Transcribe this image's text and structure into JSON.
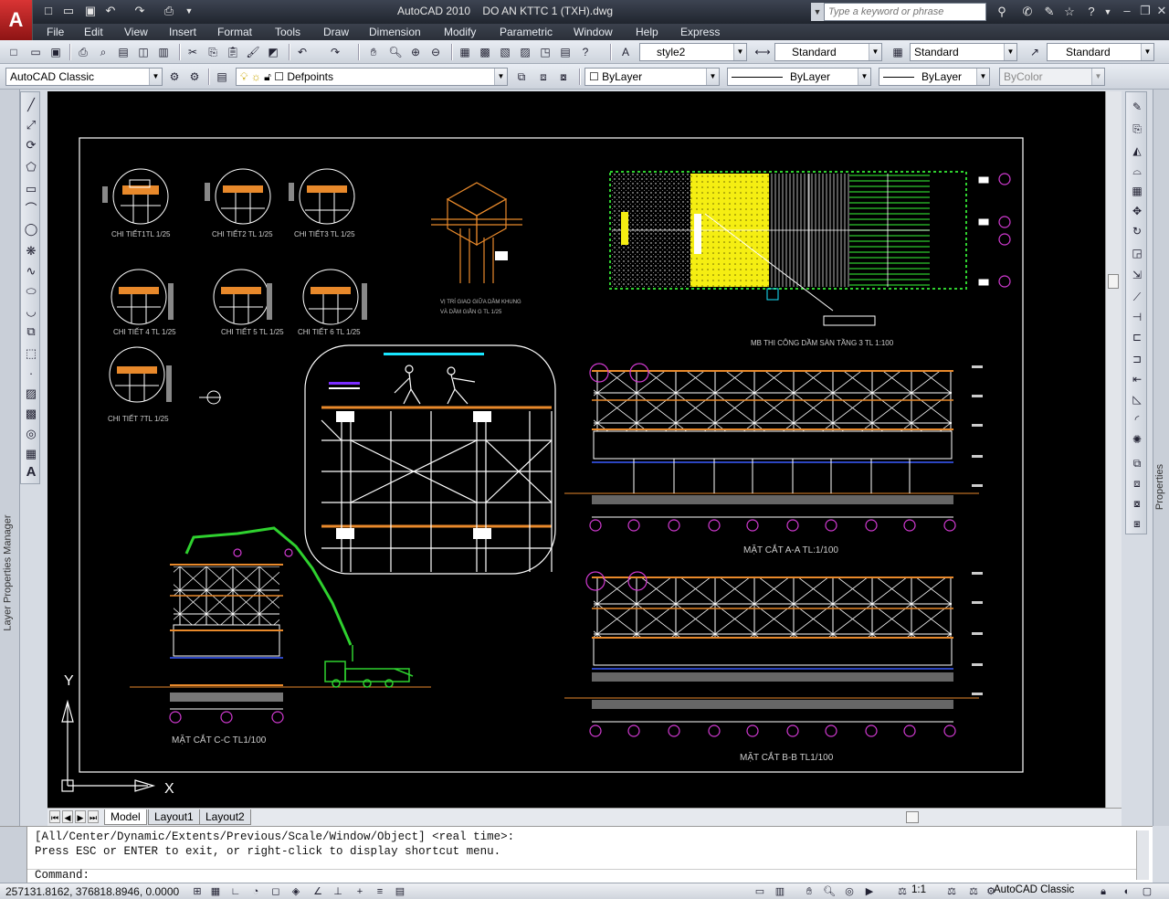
{
  "titlebar": {
    "app_name": "AutoCAD 2010",
    "file_name": "DO AN KTTC 1 (TXH).dwg",
    "search_placeholder": "Type a keyword or phrase"
  },
  "menu": [
    "File",
    "Edit",
    "View",
    "Insert",
    "Format",
    "Tools",
    "Draw",
    "Dimension",
    "Modify",
    "Parametric",
    "Window",
    "Help",
    "Express"
  ],
  "styles_toolbar": {
    "text_style": "style2",
    "dim_style": "Standard",
    "table_style": "Standard",
    "mleader_style": "Standard"
  },
  "layers_toolbar": {
    "workspace": "AutoCAD Classic",
    "layer": "Defpoints",
    "color": "ByLayer",
    "linetype": "ByLayer",
    "lineweight": "ByLayer",
    "plotstyle": "ByColor"
  },
  "side_tabs": {
    "left": "Layer Properties Manager",
    "right": "Properties"
  },
  "drawing": {
    "details": [
      "CHI TIẾT1TL 1/25",
      "CHI TIẾT2 TL 1/25",
      "CHI TIẾT3 TL 1/25",
      "CHI TIẾT 4 TL 1/25",
      "CHI TIẾT 5 TL 1/25",
      "CHI TIẾT 6 TL 1/25",
      "CHI TIẾT 7TL 1/25"
    ],
    "joint_note_1": "VỊ TRÍ GIAO GIỮA DẦM KHUNG",
    "joint_note_2": "VÀ DẦM GIẰN G TL 1/25",
    "plan_title": "MB THI CÔNG DẦM SÀN TẦNG 3 TL 1:100",
    "section_aa": "MẶT CẮT A-A TL:1/100",
    "section_bb": "MẶT CẮT B-B TL1/100",
    "section_cc": "MẶT CẮT C-C TL1/100",
    "axis_y": "Y",
    "axis_x": "X"
  },
  "layout_tabs": [
    "Model",
    "Layout1",
    "Layout2"
  ],
  "command": {
    "line1": "[All/Center/Dynamic/Extents/Previous/Scale/Window/Object] <real time>:",
    "line2": "Press ESC or ENTER to exit, or right-click to display shortcut menu.",
    "prompt": "Command:"
  },
  "status": {
    "coordinates": "257131.8162, 376818.8946, 0.0000",
    "annotation_scale": "1:1",
    "workspace": "AutoCAD Classic"
  },
  "colors": {
    "canvas": "#000000",
    "frame": "#ffffff",
    "structure": "#ffffff",
    "beam": "#e8892b",
    "dimension": "#d23ad2",
    "pump_truck": "#2fd12f",
    "slab_yellow": "#f5ee12",
    "formwork_green": "#2fd12f",
    "title_cyan": "#19e6ff"
  }
}
